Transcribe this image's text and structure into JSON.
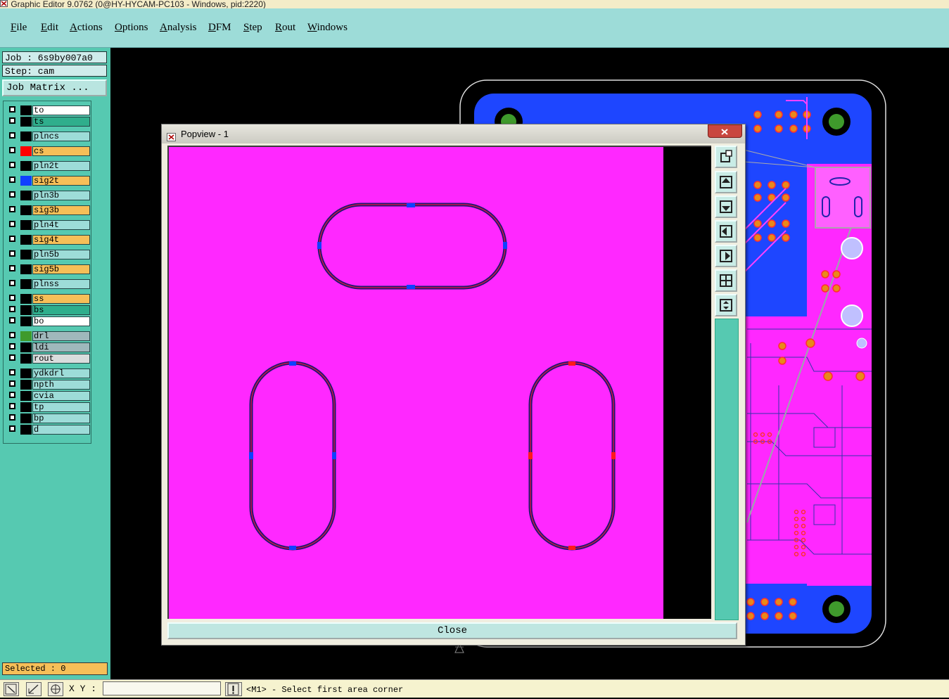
{
  "window": {
    "title": "Graphic Editor 9.0762 (0@HY-HYCAM-PC103 - Windows, pid:2220)"
  },
  "menu": [
    "File",
    "Edit",
    "Actions",
    "Options",
    "Analysis",
    "DFM",
    "Step",
    "Rout",
    "Windows"
  ],
  "job": {
    "job_label": "Job : 6s9by007a0",
    "step_label": "Step: cam",
    "job_matrix": "Job Matrix ..."
  },
  "layers": [
    {
      "name": "to",
      "swatch": "#000000",
      "bg": "#ffffff"
    },
    {
      "name": "ts",
      "swatch": "#000000",
      "bg": "#2fae8c"
    },
    {
      "name": "plncs",
      "swatch": "#000000",
      "bg": "#9ddcd8"
    },
    {
      "name": "cs",
      "swatch": "#ff0000",
      "bg": "#f6bf58"
    },
    {
      "name": "pln2t",
      "swatch": "#000000",
      "bg": "#9ddcd8"
    },
    {
      "name": "sig2t",
      "swatch": "#1040ff",
      "bg": "#f6bf58"
    },
    {
      "name": "pln3b",
      "swatch": "#000000",
      "bg": "#9ddcd8"
    },
    {
      "name": "sig3b",
      "swatch": "#000000",
      "bg": "#f6bf58"
    },
    {
      "name": "pln4t",
      "swatch": "#000000",
      "bg": "#9ddcd8"
    },
    {
      "name": "sig4t",
      "swatch": "#000000",
      "bg": "#f6bf58"
    },
    {
      "name": "pln5b",
      "swatch": "#000000",
      "bg": "#9ddcd8"
    },
    {
      "name": "sig5b",
      "swatch": "#000000",
      "bg": "#f6bf58"
    },
    {
      "name": "plnss",
      "swatch": "#000000",
      "bg": "#9ddcd8"
    },
    {
      "name": "ss",
      "swatch": "#000000",
      "bg": "#f6bf58"
    },
    {
      "name": "bs",
      "swatch": "#000000",
      "bg": "#2fae8c"
    },
    {
      "name": "bo",
      "swatch": "#000000",
      "bg": "#ffffff"
    },
    {
      "name": "drl",
      "swatch": "#3f9a2c",
      "bg": "#9fb8bb"
    },
    {
      "name": "ldi",
      "swatch": "#000000",
      "bg": "#9fb8bb"
    },
    {
      "name": "rout",
      "swatch": "#000000",
      "bg": "#d9dddd"
    },
    {
      "name": "ydkdrl",
      "swatch": "#000000",
      "bg": "#9ddcd8"
    },
    {
      "name": "npth",
      "swatch": "#000000",
      "bg": "#9ddcd8"
    },
    {
      "name": "cvia",
      "swatch": "#000000",
      "bg": "#9ddcd8"
    },
    {
      "name": "tp",
      "swatch": "#000000",
      "bg": "#9ddcd8"
    },
    {
      "name": "bp",
      "swatch": "#000000",
      "bg": "#9ddcd8"
    },
    {
      "name": "d",
      "swatch": "#000000",
      "bg": "#9ddcd8"
    }
  ],
  "selected": "Selected : 0",
  "statusbar": {
    "xy_label": "X Y :",
    "xy_value": "",
    "message": "<M1> - Select first area corner"
  },
  "popview": {
    "title": "Popview - 1",
    "close_label": "Close"
  },
  "colors": {
    "panel": "#56c9b1",
    "menu": "#9ddcd8",
    "board_blue": "#1e46ff",
    "board_magenta": "#ff28ff",
    "pad_orange": "#e88a1a",
    "drill_green": "#3f9a2c"
  }
}
